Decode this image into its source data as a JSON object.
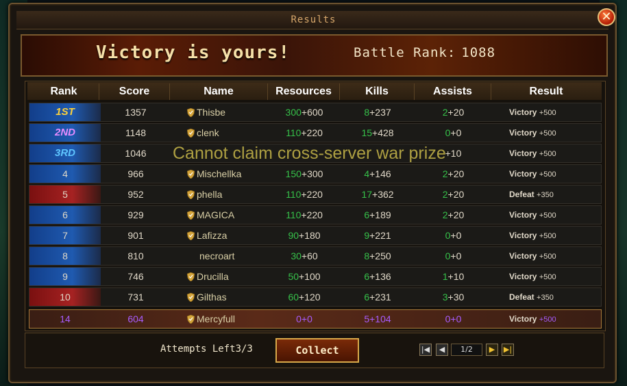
{
  "window": {
    "title": "Results",
    "close_glyph": "✕"
  },
  "banner": {
    "headline": "Victory is yours!",
    "battle_rank_label": "Battle Rank:",
    "battle_rank_value": "1088"
  },
  "columns": [
    "Rank",
    "Score",
    "Name",
    "Resources",
    "Kills",
    "Assists",
    "Result"
  ],
  "rows": [
    {
      "rank": "1ST",
      "score": "1357",
      "name": "Thisbe",
      "badge": true,
      "res_a": "300",
      "res_b": "+600",
      "kills_a": "8",
      "kills_b": "+237",
      "ast_a": "2",
      "ast_b": "+20",
      "result": "Victory",
      "bonus": "+500",
      "type": "victory",
      "medal": "gold"
    },
    {
      "rank": "2ND",
      "score": "1148",
      "name": "clenk",
      "badge": true,
      "res_a": "110",
      "res_b": "+220",
      "kills_a": "15",
      "kills_b": "+428",
      "ast_a": "0",
      "ast_b": "+0",
      "result": "Victory",
      "bonus": "+500",
      "type": "victory",
      "medal": "pink"
    },
    {
      "rank": "3RD",
      "score": "1046",
      "name": "",
      "badge": false,
      "res_a": "",
      "res_b": "",
      "kills_a": "",
      "kills_b": "",
      "ast_a": "",
      "ast_b": "+10",
      "result": "Victory",
      "bonus": "+500",
      "type": "victory",
      "medal": "blue"
    },
    {
      "rank": "4",
      "score": "966",
      "name": "Mischellka",
      "badge": true,
      "res_a": "150",
      "res_b": "+300",
      "kills_a": "4",
      "kills_b": "+146",
      "ast_a": "2",
      "ast_b": "+20",
      "result": "Victory",
      "bonus": "+500",
      "type": "victory"
    },
    {
      "rank": "5",
      "score": "952",
      "name": "phella",
      "badge": true,
      "res_a": "110",
      "res_b": "+220",
      "kills_a": "17",
      "kills_b": "+362",
      "ast_a": "2",
      "ast_b": "+20",
      "result": "Defeat",
      "bonus": "+350",
      "type": "defeat"
    },
    {
      "rank": "6",
      "score": "929",
      "name": "MAGICA",
      "badge": true,
      "res_a": "110",
      "res_b": "+220",
      "kills_a": "6",
      "kills_b": "+189",
      "ast_a": "2",
      "ast_b": "+20",
      "result": "Victory",
      "bonus": "+500",
      "type": "victory"
    },
    {
      "rank": "7",
      "score": "901",
      "name": "Lafizza",
      "badge": true,
      "res_a": "90",
      "res_b": "+180",
      "kills_a": "9",
      "kills_b": "+221",
      "ast_a": "0",
      "ast_b": "+0",
      "result": "Victory",
      "bonus": "+500",
      "type": "victory"
    },
    {
      "rank": "8",
      "score": "810",
      "name": "necroart",
      "badge": false,
      "res_a": "30",
      "res_b": "+60",
      "kills_a": "8",
      "kills_b": "+250",
      "ast_a": "0",
      "ast_b": "+0",
      "result": "Victory",
      "bonus": "+500",
      "type": "victory"
    },
    {
      "rank": "9",
      "score": "746",
      "name": "Drucilla",
      "badge": true,
      "res_a": "50",
      "res_b": "+100",
      "kills_a": "6",
      "kills_b": "+136",
      "ast_a": "1",
      "ast_b": "+10",
      "result": "Victory",
      "bonus": "+500",
      "type": "victory"
    },
    {
      "rank": "10",
      "score": "731",
      "name": "Gilthas",
      "badge": true,
      "res_a": "60",
      "res_b": "+120",
      "kills_a": "6",
      "kills_b": "+231",
      "ast_a": "3",
      "ast_b": "+30",
      "result": "Defeat",
      "bonus": "+350",
      "type": "defeat"
    },
    {
      "rank": "14",
      "score": "604",
      "name": "Mercyfull",
      "badge": true,
      "res_a": "0",
      "res_b": "+0",
      "kills_a": "5",
      "kills_b": "+104",
      "ast_a": "0",
      "ast_b": "+0",
      "result": "Victory",
      "bonus": "+500",
      "type": "self"
    }
  ],
  "overlay_message": "Cannot claim cross-server war prize",
  "footer": {
    "attempts_label": "Attempts Left",
    "attempts_value": "3/3",
    "collect_label": "Collect",
    "page_indicator": "1/2",
    "first_glyph": "|◀",
    "prev_glyph": "◀",
    "next_glyph": "▶",
    "last_glyph": "▶|"
  },
  "colors": {
    "green": "#36c24a",
    "gold": "#ffd23a",
    "victory_bg": "#1f5ab0",
    "defeat_bg": "#a62222"
  }
}
